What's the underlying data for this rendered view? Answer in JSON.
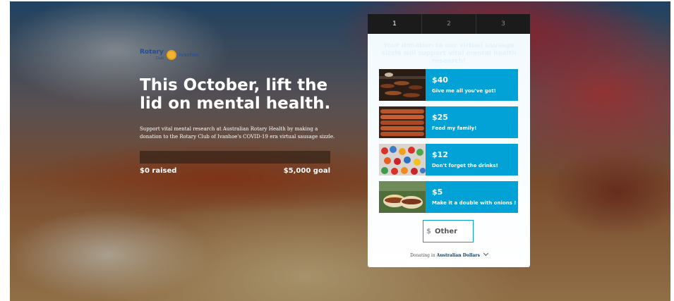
{
  "brand": {
    "name": "Rotary",
    "sub": "Club",
    "location": "Ivanhoe"
  },
  "hero": {
    "title": "This October, lift the lid on mental health.",
    "description": "Support vital mental research at Australian Rotary Health by making a donation to the Rotary Club of Ivanhoe's COVID-19 era virtual sausage sizzle.",
    "raised": "$0 raised",
    "goal": "$5,000 goal",
    "progress_fraction": 0
  },
  "steps": [
    "1",
    "2",
    "3"
  ],
  "panel": {
    "heading": "Your donation to our virtual sausage sizzle will support vital mental health research!",
    "tiers": [
      {
        "amount": "$40",
        "label": "Give me all you've got!"
      },
      {
        "amount": "$25",
        "label": "Feed my family!"
      },
      {
        "amount": "$12",
        "label": "Don't forget the drinks!"
      },
      {
        "amount": "$5",
        "label": "Make it a double with onions !"
      }
    ],
    "other": {
      "symbol": "$",
      "placeholder": "Other"
    },
    "currency": {
      "prefix": "Donating in",
      "name": "Australian Dollars"
    }
  },
  "colors": {
    "accent": "#03a2d6",
    "step_bar": "#1b1b1b",
    "brand_blue": "#1f4e9c"
  },
  "icons": {
    "currency_dropdown": "chevron-down-icon",
    "rotary_logo": "rotary-wheel-icon"
  }
}
